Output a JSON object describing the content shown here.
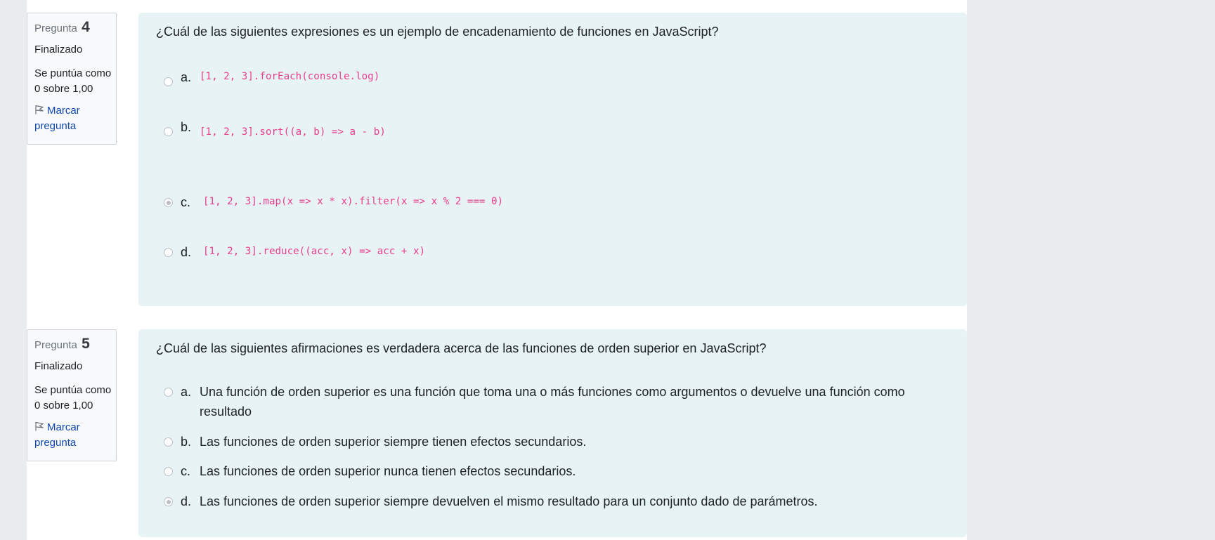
{
  "questions": [
    {
      "label": "Pregunta",
      "number": "4",
      "state": "Finalizado",
      "grade_line1": "Se puntúa como",
      "grade_line2": "0 sobre 1,00",
      "flag_line1": "Marcar",
      "flag_line2": "pregunta",
      "text": "¿Cuál de las siguientes expresiones es un ejemplo de encadenamiento de funciones en JavaScript?",
      "answers": [
        {
          "letter": "a.",
          "text": "[1, 2, 3].forEach(console.log)",
          "selected": false
        },
        {
          "letter": "b.",
          "text": "[1, 2, 3].sort((a, b) => a - b)",
          "selected": false
        },
        {
          "letter": "c.",
          "text": "[1, 2, 3].map(x => x * x).filter(x => x % 2 === 0)",
          "selected": true
        },
        {
          "letter": "d.",
          "text": "[1, 2, 3].reduce((acc, x) => acc + x)",
          "selected": false
        }
      ]
    },
    {
      "label": "Pregunta",
      "number": "5",
      "state": "Finalizado",
      "grade_line1": "Se puntúa como",
      "grade_line2": "0 sobre 1,00",
      "flag_line1": "Marcar",
      "flag_line2": "pregunta",
      "text": "¿Cuál de las siguientes afirmaciones es verdadera acerca de las funciones de orden superior en JavaScript?",
      "answers": [
        {
          "letter": "a.",
          "text": "Una función de orden superior es una función que toma una o más funciones como argumentos o devuelve una función como resultado",
          "selected": false
        },
        {
          "letter": "b.",
          "text": "Las funciones de orden superior siempre tienen efectos secundarios.",
          "selected": false
        },
        {
          "letter": "c.",
          "text": "Las funciones de orden superior nunca tienen efectos secundarios.",
          "selected": false
        },
        {
          "letter": "d.",
          "text": "Las funciones de orden superior siempre devuelven el mismo resultado para un conjunto dado de parámetros.",
          "selected": true
        }
      ]
    }
  ],
  "colors": {
    "page_bg": "#e9ecef",
    "content_bg": "#e7f3f5",
    "code": "#e83e8c",
    "link": "#0f47ad"
  }
}
